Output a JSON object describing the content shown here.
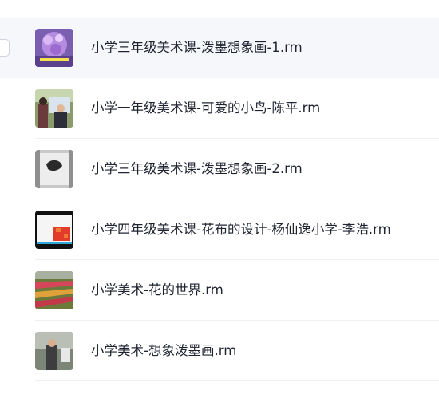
{
  "files": [
    {
      "name": "小学三年级美术课-泼墨想象画-1.rm",
      "thumb_icon": "purple-flower-video-thumbnail",
      "selected": true
    },
    {
      "name": "小学一年级美术课-可爱的小鸟-陈平.rm",
      "thumb_icon": "classroom-video-thumbnail",
      "selected": false
    },
    {
      "name": "小学三年级美术课-泼墨想象画-2.rm",
      "thumb_icon": "ink-painting-video-thumbnail",
      "selected": false
    },
    {
      "name": "小学四年级美术课-花布的设计-杨仙逸小学-李浩.rm",
      "thumb_icon": "fabric-design-video-thumbnail",
      "selected": false
    },
    {
      "name": "小学美术-花的世界.rm",
      "thumb_icon": "flower-field-video-thumbnail",
      "selected": false
    },
    {
      "name": "小学美术-想象泼墨画.rm",
      "thumb_icon": "teacher-video-thumbnail",
      "selected": false
    }
  ],
  "colors": {
    "selected_row_bg": "#f6f7fb",
    "text": "#1f2430",
    "divider": "#eef0f4"
  }
}
